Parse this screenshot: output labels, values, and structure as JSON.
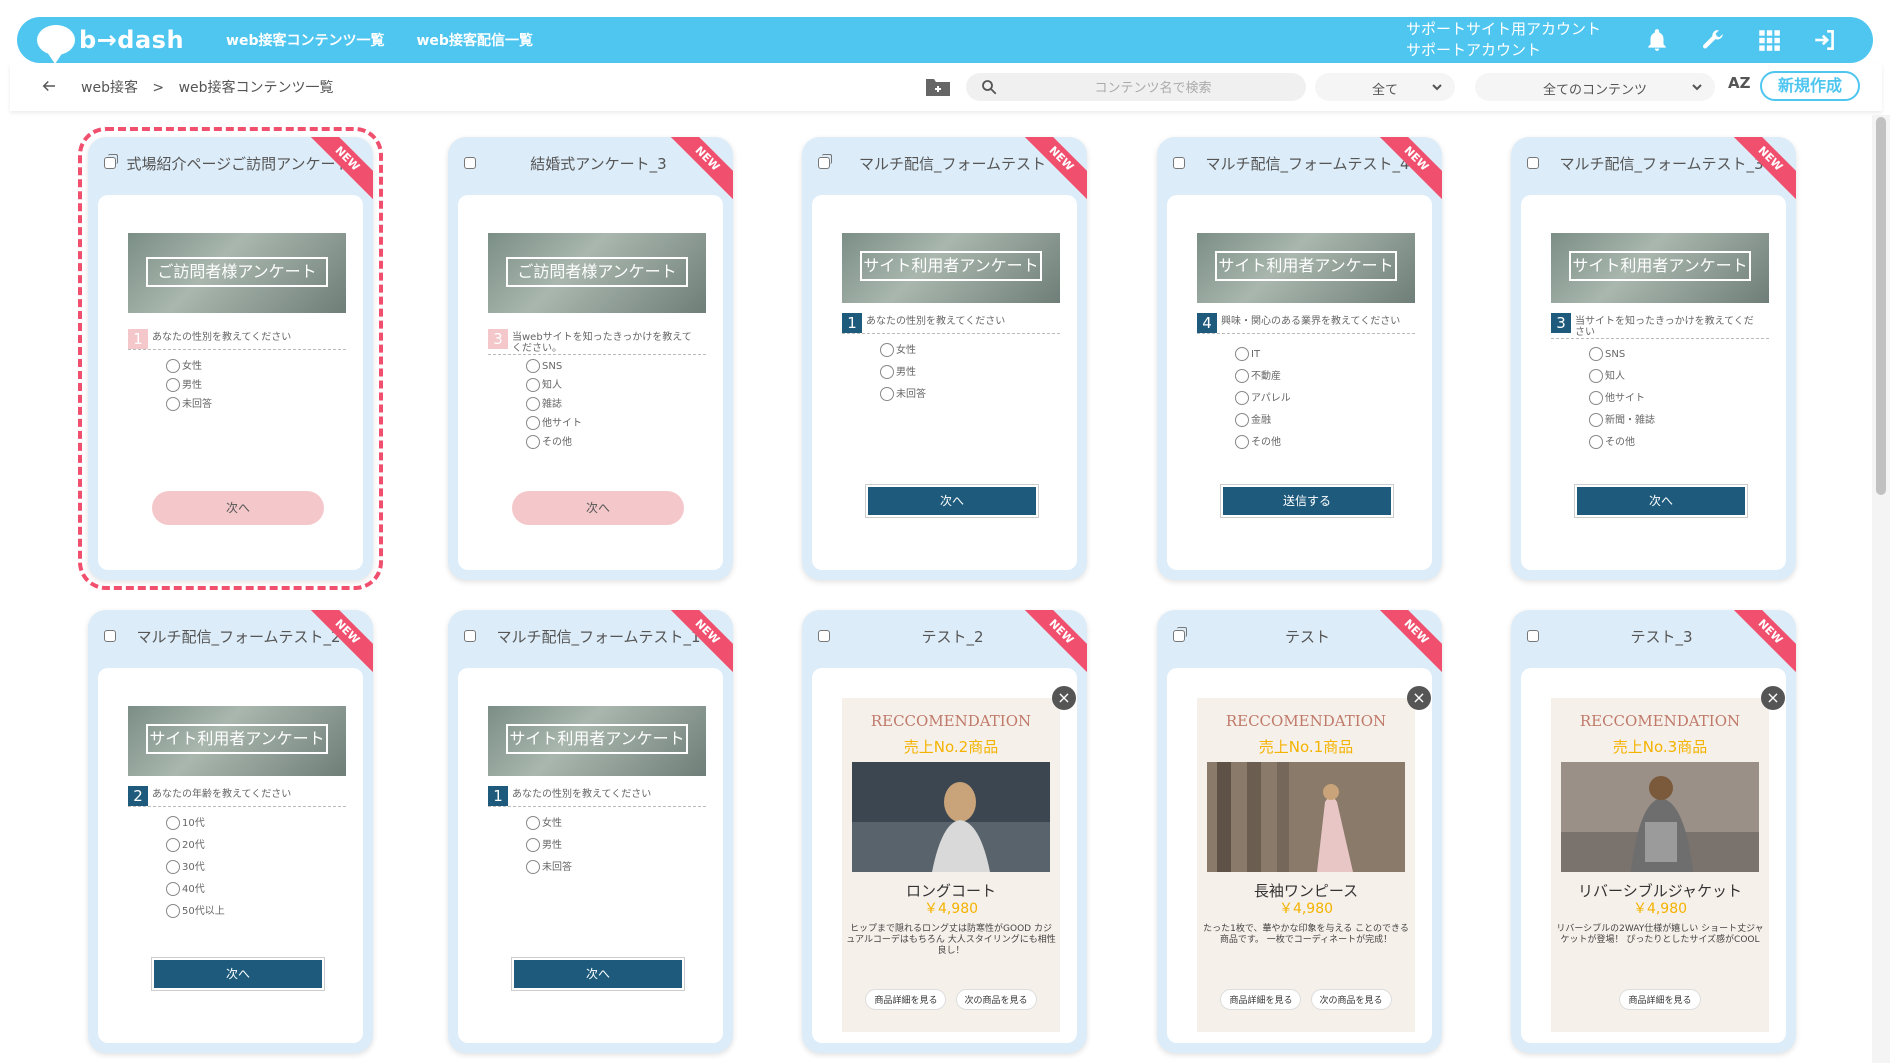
{
  "header": {
    "logo": "b→dash",
    "nav": [
      "web接客コンテンツ一覧",
      "web接客配信一覧"
    ],
    "account_line1": "サポートサイト用アカウント",
    "account_line2": "サポートアカウント",
    "icons": [
      "bell-icon",
      "wrench-icon",
      "grid-icon",
      "logout-icon"
    ]
  },
  "toolbar": {
    "breadcrumb": [
      "web接客",
      ">",
      "web接客コンテンツ一覧"
    ],
    "search_placeholder": "コンテンツ名で検索",
    "filter_all": "全て",
    "filter_contents": "全てのコンテンツ",
    "sort_label": "AZ",
    "new_button": "新規作成"
  },
  "colors": {
    "accent": "#4fc6f0",
    "ribbon": "#f0506e",
    "navy": "#1e5a7c",
    "pink": "#f4c7cb"
  },
  "cards": [
    {
      "title": "式場紹介ページご訪問アンケート",
      "badge": "NEW",
      "hero": "ご訪問者様アンケート",
      "q_num": "1",
      "question": "あなたの性別を教えてください",
      "options": [
        "女性",
        "男性",
        "未回答"
      ],
      "button": "次へ"
    },
    {
      "title": "結婚式アンケート_3",
      "badge": "NEW",
      "hero": "ご訪問者様アンケート",
      "q_num": "3",
      "question": "当webサイトを知ったきっかけを教えてください。",
      "options": [
        "SNS",
        "知人",
        "雑誌",
        "他サイト",
        "その他"
      ],
      "button": "次へ"
    },
    {
      "title": "マルチ配信_フォームテスト",
      "badge": "NEW",
      "hero": "サイト利用者アンケート",
      "q_num": "1",
      "question": "あなたの性別を教えてください",
      "options": [
        "女性",
        "男性",
        "未回答"
      ],
      "button": "次へ"
    },
    {
      "title": "マルチ配信_フォームテスト_4",
      "badge": "NEW",
      "hero": "サイト利用者アンケート",
      "q_num": "4",
      "question": "興味・関心のある業界を教えてください",
      "options": [
        "IT",
        "不動産",
        "アパレル",
        "金融",
        "その他"
      ],
      "button": "送信する"
    },
    {
      "title": "マルチ配信_フォームテスト_3",
      "badge": "NEW",
      "hero": "サイト利用者アンケート",
      "q_num": "3",
      "question": "当サイトを知ったきっかけを教えてください",
      "options": [
        "SNS",
        "知人",
        "他サイト",
        "新聞・雑誌",
        "その他"
      ],
      "button": "次へ"
    },
    {
      "title": "マルチ配信_フォームテスト_2",
      "badge": "NEW",
      "hero": "サイト利用者アンケート",
      "q_num": "2",
      "question": "あなたの年齢を教えてください",
      "options": [
        "10代",
        "20代",
        "30代",
        "40代",
        "50代以上"
      ],
      "button": "次へ"
    },
    {
      "title": "マルチ配信_フォームテスト_1",
      "badge": "NEW",
      "hero": "サイト利用者アンケート",
      "q_num": "1",
      "question": "あなたの性別を教えてください",
      "options": [
        "女性",
        "男性",
        "未回答"
      ],
      "button": "次へ"
    },
    {
      "title": "テスト_2",
      "badge": "NEW",
      "rec_title": "RECCOMENDATION",
      "rec_sub": "売上No.2商品",
      "product": "ロングコート",
      "price": "￥4,980",
      "desc": "ヒップまで隠れるロング丈は防寒性がGOOD カジュアルコーデはもちろん 大人スタイリングにも相性良し！",
      "btn1": "商品詳細を見る",
      "btn2": "次の商品を見る"
    },
    {
      "title": "テスト",
      "badge": "NEW",
      "rec_title": "RECCOMENDATION",
      "rec_sub": "売上No.1商品",
      "product": "長袖ワンピース",
      "price": "￥4,980",
      "desc": "たった1枚で、華やかな印象を与える ことのできる商品です。 一枚でコーディネートが完成！",
      "btn1": "商品詳細を見る",
      "btn2": "次の商品を見る"
    },
    {
      "title": "テスト_3",
      "badge": "NEW",
      "rec_title": "RECCOMENDATION",
      "rec_sub": "売上No.3商品",
      "product": "リバーシブルジャケット",
      "price": "￥4,980",
      "desc": "リバーシブルの2WAY仕様が嬉しい ショート丈ジャケットが登場！ ぴったりとしたサイズ感がCOOL",
      "btn1": "商品詳細を見る"
    }
  ]
}
